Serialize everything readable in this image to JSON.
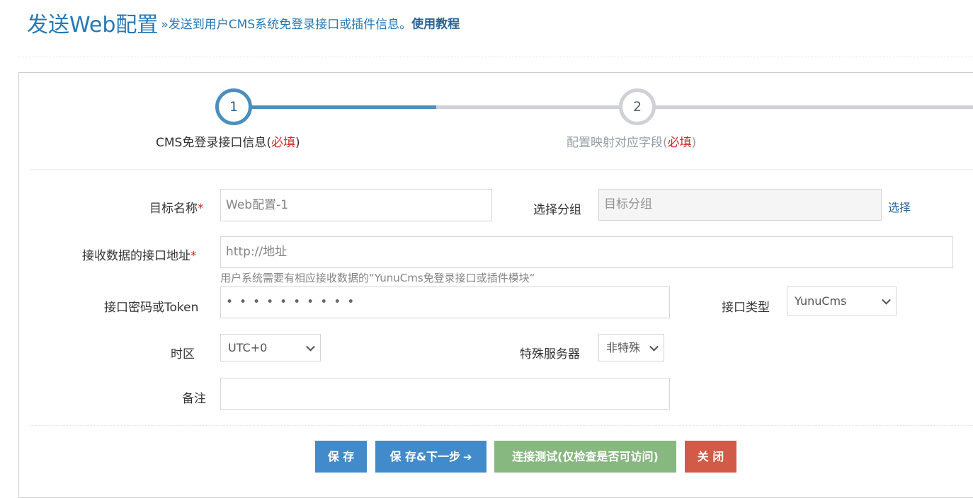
{
  "header": {
    "title": "发送Web配置",
    "subtitle": "»发送到用户CMS系统免登录接口或插件信息。",
    "tutorial_link": "使用教程"
  },
  "steps": [
    {
      "number": "1",
      "title": "CMS免登录接口信息(",
      "required": "必填",
      "close": ")",
      "active": true
    },
    {
      "number": "2",
      "title": "配置映射对应字段(",
      "required": "必填",
      "close": ")",
      "active": false
    }
  ],
  "form": {
    "target_name": {
      "label": "目标名称",
      "required_mark": "*",
      "value": "Web配置-1"
    },
    "group": {
      "label": "选择分组",
      "placeholder": "目标分组",
      "choose_link": "选择"
    },
    "api_url": {
      "label": "接收数据的接口地址",
      "required_mark": "*",
      "placeholder": "http://地址",
      "help": "用户系统需要有相应接收数据的“YunuCms免登录接口或插件模块“"
    },
    "token": {
      "label": "接口密码或Token",
      "masked_value": "••••••••••"
    },
    "api_type": {
      "label": "接口类型",
      "value": "YunuCms"
    },
    "timezone": {
      "label": "时区",
      "value": "UTC+0"
    },
    "special_server": {
      "label": "特殊服务器",
      "value": "非特殊"
    },
    "remark": {
      "label": "备注",
      "value": ""
    }
  },
  "buttons": {
    "save": "保 存",
    "save_next": "保 存&下一步",
    "test": "连接测试(仅检查是否可访问)",
    "close": "关 闭"
  },
  "colors": {
    "primary": "#428bca",
    "success": "#87b87f",
    "danger": "#d15b47",
    "title_blue": "#2679b5",
    "step_active": "#4c8fbd",
    "step_inactive": "#ced1d6",
    "required_red": "#d12723"
  }
}
